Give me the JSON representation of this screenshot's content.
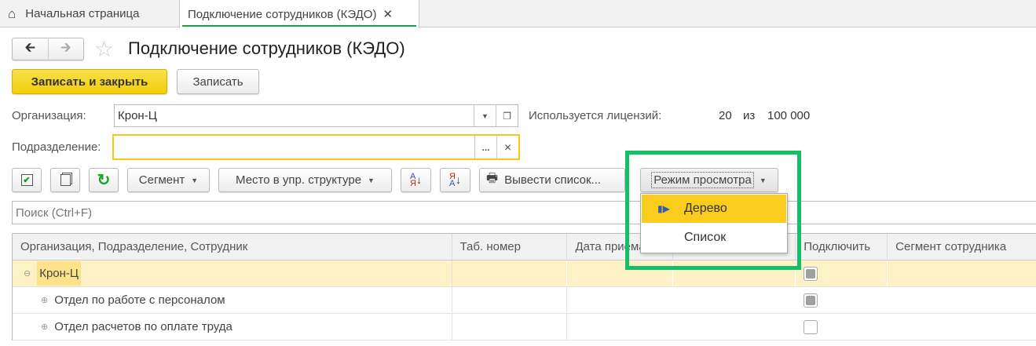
{
  "tabs": [
    {
      "label": "Начальная страница"
    },
    {
      "label": "Подключение сотрудников (КЭДО)"
    }
  ],
  "title": "Подключение сотрудников (КЭДО)",
  "buttons": {
    "save_close": "Записать и закрыть",
    "save": "Записать"
  },
  "org": {
    "label": "Организация:",
    "value": "Крон-Ц"
  },
  "licenses": {
    "label": "Используется лицензий:",
    "used": "20",
    "of": "из",
    "total": "100 000"
  },
  "subdivision": {
    "label": "Подразделение:",
    "value": "",
    "dots": "..."
  },
  "toolbar": {
    "segment": "Сегмент",
    "place": "Место в упр. структуре",
    "print": "Вывести список...",
    "view_mode": "Режим просмотра"
  },
  "dropdown": {
    "items": [
      {
        "label": "Дерево",
        "selected": true
      },
      {
        "label": "Список",
        "selected": false
      }
    ]
  },
  "search": {
    "placeholder": "Поиск (Ctrl+F)"
  },
  "table": {
    "columns": [
      "Организация, Подразделение, Сотрудник",
      "Таб. номер",
      "Дата приема",
      "",
      "Подключить",
      "Сегмент сотрудника"
    ],
    "rows": [
      {
        "name": "Крон-Ц",
        "connect": "indeterminate"
      },
      {
        "name": "Отдел по работе с персоналом",
        "connect": "indeterminate"
      },
      {
        "name": "Отдел расчетов по оплате труда",
        "connect": "unchecked"
      }
    ]
  },
  "colors": {
    "accent": "#f0cf0a",
    "highlight": "#12c066",
    "selected_row": "#fdf2c6"
  }
}
